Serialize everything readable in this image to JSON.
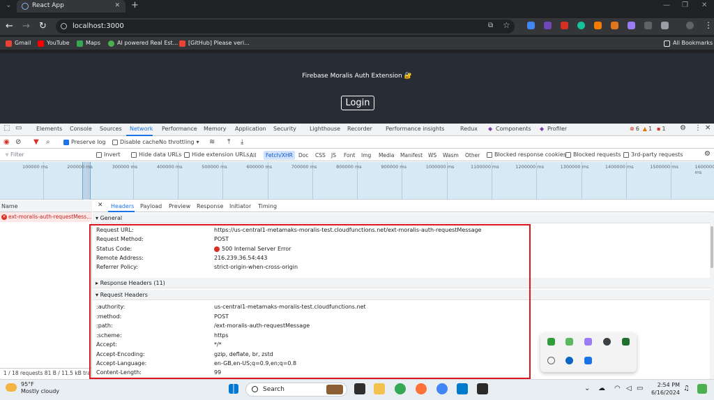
{
  "browser": {
    "tab_title": "React App",
    "url": "localhost:3000",
    "bookmarks": [
      "Gmail",
      "YouTube",
      "Maps",
      "AI powered Real Est...",
      "[GitHub] Please veri..."
    ],
    "all_bookmarks": "All Bookmarks"
  },
  "page": {
    "title": "Firebase Moralis Auth Extension 🔐",
    "login_label": "Login"
  },
  "devtools": {
    "tabs": [
      "Elements",
      "Console",
      "Sources",
      "Network",
      "Performance",
      "Memory",
      "Application",
      "Security",
      "Lighthouse",
      "Recorder",
      "Performance insights",
      "Redux",
      "Components",
      "Profiler"
    ],
    "active_tab": "Network",
    "error_count": "6",
    "warning_count": "1",
    "issue_count": "1",
    "toolbar": {
      "preserve_log": "Preserve log",
      "disable_cache": "Disable cache",
      "throttling": "No throttling"
    },
    "filter": {
      "placeholder": "Filter",
      "invert": "Invert",
      "hide_data_urls": "Hide data URLs",
      "hide_extension_urls": "Hide extension URLs",
      "types": [
        "All",
        "Fetch/XHR",
        "Doc",
        "CSS",
        "JS",
        "Font",
        "Img",
        "Media",
        "Manifest",
        "WS",
        "Wasm",
        "Other"
      ],
      "active_type": "Fetch/XHR",
      "blocked_cookies": "Blocked response cookies",
      "blocked_requests": "Blocked requests",
      "third_party": "3rd-party requests"
    },
    "timeline_ticks": [
      "100000 ms",
      "200000 ms",
      "300000 ms",
      "400000 ms",
      "500000 ms",
      "600000 ms",
      "700000 ms",
      "800000 ms",
      "900000 ms",
      "1000000 ms",
      "1100000 ms",
      "1200000 ms",
      "1300000 ms",
      "1400000 ms",
      "1500000 ms",
      "1600000 ms"
    ],
    "name_header": "Name",
    "request_name": "ext-moralis-auth-requestMess...",
    "summary": "1 / 18 requests    81 B / 11.5 kB tra",
    "detail_tabs": [
      "Headers",
      "Payload",
      "Preview",
      "Response",
      "Initiator",
      "Timing"
    ],
    "general_title": "General",
    "general": [
      {
        "k": "Request URL:",
        "v": "https://us-central1-metamaks-moralis-test.cloudfunctions.net/ext-moralis-auth-requestMessage"
      },
      {
        "k": "Request Method:",
        "v": "POST"
      },
      {
        "k": "Status Code:",
        "v": "500 Internal Server Error"
      },
      {
        "k": "Remote Address:",
        "v": "216.239.36.54:443"
      },
      {
        "k": "Referrer Policy:",
        "v": "strict-origin-when-cross-origin"
      }
    ],
    "response_headers_title": "Response Headers (11)",
    "request_headers_title": "Request Headers",
    "request_headers": [
      {
        "k": ":authority:",
        "v": "us-central1-metamaks-moralis-test.cloudfunctions.net"
      },
      {
        "k": ":method:",
        "v": "POST"
      },
      {
        "k": ":path:",
        "v": "/ext-moralis-auth-requestMessage"
      },
      {
        "k": ":scheme:",
        "v": "https"
      },
      {
        "k": "Accept:",
        "v": "*/*"
      },
      {
        "k": "Accept-Encoding:",
        "v": "gzip, deflate, br, zstd"
      },
      {
        "k": "Accept-Language:",
        "v": "en-GB,en-US;q=0.9,en;q=0.8"
      },
      {
        "k": "Content-Length:",
        "v": "99"
      }
    ]
  },
  "taskbar": {
    "temp": "95°F",
    "weather": "Mostly cloudy",
    "search": "Search",
    "time": "2:54 PM",
    "date": "6/16/2024"
  }
}
